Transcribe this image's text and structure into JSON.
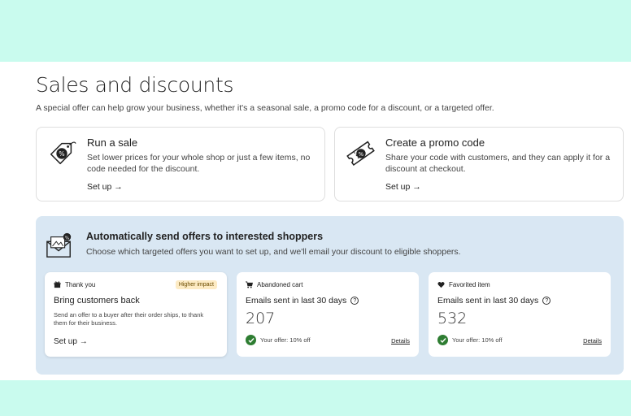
{
  "title": "Sales and discounts",
  "subtitle": "A special offer can help grow your business, whether it's a seasonal sale, a promo code for a discount, or a targeted offer.",
  "sale_card": {
    "icon": "price-tag-icon",
    "title": "Run a sale",
    "desc": "Set lower prices for your whole shop or just a few items, no code needed for the discount.",
    "link": "Set up →"
  },
  "promo_card": {
    "icon": "coupon-icon",
    "title": "Create a promo code",
    "desc": "Share your code with customers, and they can apply it for a discount at checkout.",
    "link": "Set up →"
  },
  "auto_offers": {
    "icon": "mail-offer-icon",
    "title": "Automatically send offers to interested shoppers",
    "desc": "Choose which targeted offers you want to set up, and we'll email your discount to eligible shoppers.",
    "cards": [
      {
        "icon": "gift-icon",
        "label": "Thank you",
        "badge": "Higher impact",
        "title": "Bring customers back",
        "desc": "Send an offer to a buyer after their order ships, to thank them for their business.",
        "link": "Set up →"
      },
      {
        "icon": "cart-icon",
        "label": "Abandoned cart",
        "emails_label": "Emails sent in last 30 days",
        "count": "207",
        "offer": "Your offer: 10% off",
        "details": "Details"
      },
      {
        "icon": "heart-icon",
        "label": "Favorited item",
        "emails_label": "Emails sent in last 30 days",
        "count": "532",
        "offer": "Your offer: 10% off",
        "details": "Details"
      }
    ]
  },
  "colors": {
    "frame": "#c9fbee",
    "panel": "#d9e7f3",
    "badge_bg": "#fdebc4",
    "check": "#2e7d32"
  }
}
